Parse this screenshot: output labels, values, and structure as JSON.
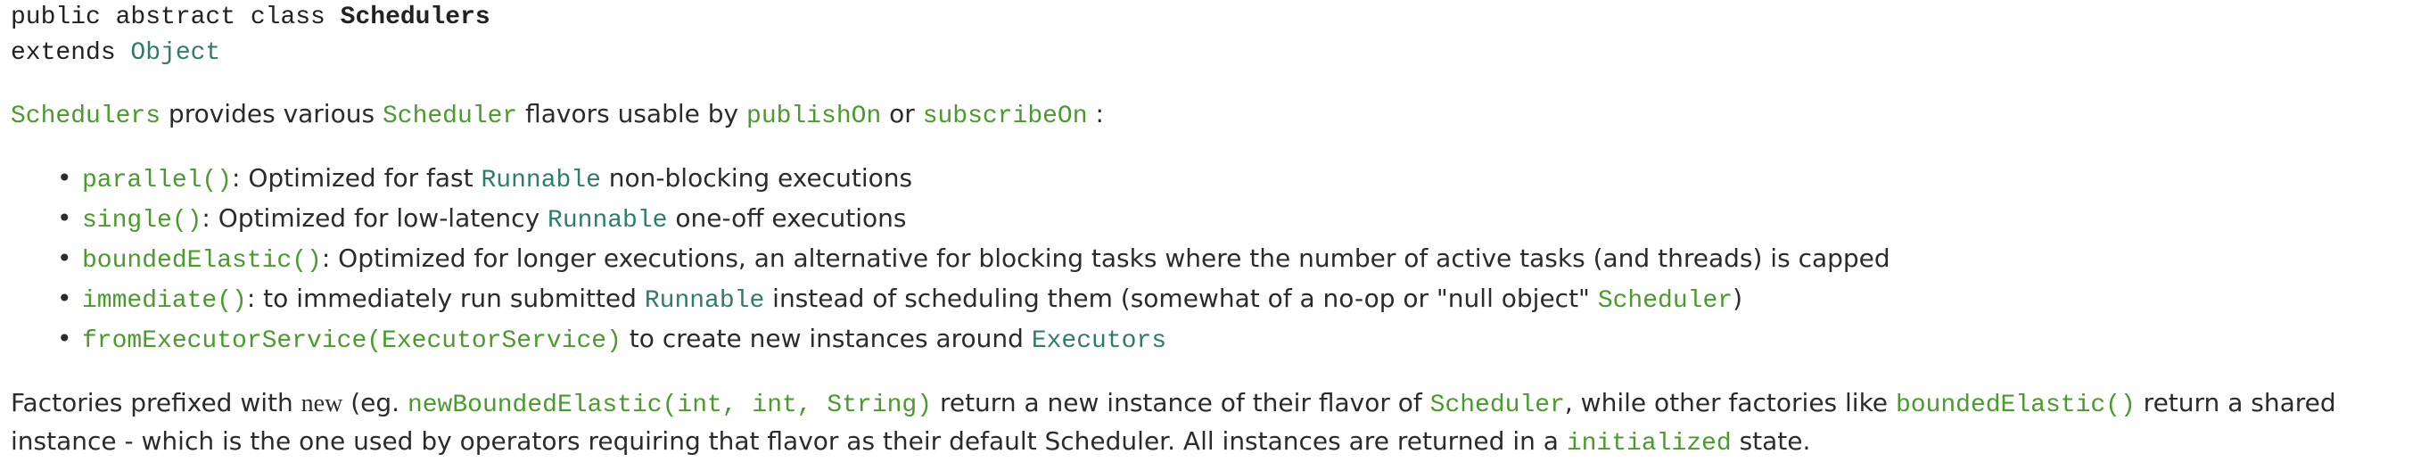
{
  "signature": {
    "line1_prefix": "public abstract class ",
    "class_name": "Schedulers",
    "line2_prefix": "extends ",
    "superclass": "Object"
  },
  "intro": {
    "subject": "Schedulers",
    "t1": " provides various ",
    "scheduler": "Scheduler",
    "t2": " flavors usable by ",
    "publish_on": "publishOn",
    "t3": " or ",
    "subscribe_on": "subscribeOn",
    "t4": " :"
  },
  "items": [
    {
      "method": "parallel()",
      "t1": ": Optimized for fast ",
      "ref": "Runnable",
      "t2": " non-blocking executions"
    },
    {
      "method": "single()",
      "t1": ": Optimized for low-latency ",
      "ref": "Runnable",
      "t2": " one-off executions"
    },
    {
      "method": "boundedElastic()",
      "t1": ": Optimized for longer executions, an alternative for blocking tasks where the number of active tasks (and threads) is capped"
    },
    {
      "method": "immediate()",
      "t1": ": to immediately run submitted ",
      "ref": "Runnable",
      "t2": " instead of scheduling them (somewhat of a no-op or \"null object\" ",
      "ref2": "Scheduler",
      "t3": ")"
    },
    {
      "method": "fromExecutorService(ExecutorService)",
      "t1": " to create new instances around ",
      "ref": "Executors"
    }
  ],
  "factories": {
    "t1": "Factories prefixed with ",
    "new_kw": "new",
    "t2": " (eg. ",
    "example": "newBoundedElastic(int, int, String)",
    "t3": " return a new instance of their flavor of ",
    "scheduler": "Scheduler",
    "t4": ", while other factories like ",
    "bounded": "boundedElastic()",
    "t5": " return a shared instance - which is the one used by operators requiring that flavor as their default Scheduler. All instances are returned in a ",
    "initialized": "initialized",
    "t6": " state."
  },
  "colors": {
    "link_green": "#4a9a2c",
    "link_teal": "#2e7d6b",
    "text": "#2b2b2b"
  }
}
